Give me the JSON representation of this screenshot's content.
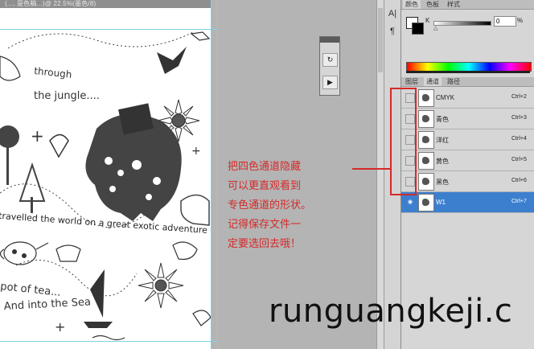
{
  "document": {
    "title_strip": "(..., 是色稿...)@ 22.5%(墨色/8)"
  },
  "artwork": {
    "line1": "through",
    "line2": "the jungle....",
    "line3": "travelled the world on a great exotic adventure",
    "line4": "pot of tea...",
    "line5": "And into the Sea"
  },
  "tools": {
    "type_icon": "A|",
    "paragraph_icon": "¶"
  },
  "float_panel": {
    "btn1_icon": "history-brush-icon",
    "btn2_icon": "play-action-icon"
  },
  "color_panel": {
    "tabs": [
      "颜色",
      "色板",
      "样式"
    ],
    "channel_label": "K",
    "value": "0",
    "unit": "%"
  },
  "layers_panel": {
    "tabs": [
      "图层",
      "通道",
      "路径"
    ],
    "channels": [
      {
        "name": "CMYK",
        "shortcut": "Ctrl+2",
        "visible": false,
        "selected": false
      },
      {
        "name": "青色",
        "shortcut": "Ctrl+3",
        "visible": false,
        "selected": false
      },
      {
        "name": "洋红",
        "shortcut": "Ctrl+4",
        "visible": false,
        "selected": false
      },
      {
        "name": "黄色",
        "shortcut": "Ctrl+5",
        "visible": false,
        "selected": false
      },
      {
        "name": "黑色",
        "shortcut": "Ctrl+6",
        "visible": false,
        "selected": false
      },
      {
        "name": "W1",
        "shortcut": "Ctrl+7",
        "visible": true,
        "selected": true
      }
    ]
  },
  "annotation": {
    "lines": [
      "把四色通道隐藏",
      "可以更直观看到",
      "专色通道的形状。",
      "记得保存文件一",
      "定要选回去哦！"
    ]
  },
  "watermark": {
    "text": "runguangkeji.c"
  },
  "colors": {
    "accent_red": "#d42a2a",
    "selection_blue": "#3d7fcf"
  }
}
